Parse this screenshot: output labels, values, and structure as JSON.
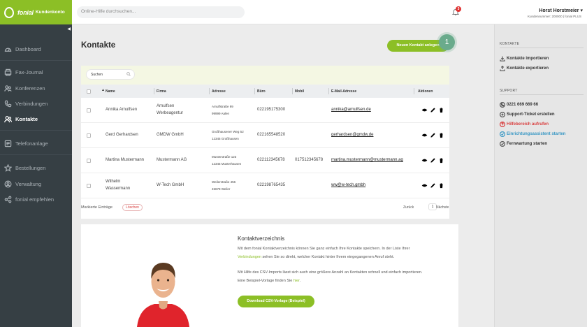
{
  "brand": {
    "name": "fonial",
    "subtitle": "Kundenkonto"
  },
  "topbar": {
    "search_placeholder": "Online-Hilfe durchsuchen...",
    "notification_count": "3",
    "user_name": "Horst Horstmeier ▾",
    "user_sub": "Kundennummer: 200000 | fonial PLUS"
  },
  "sidebar": {
    "collapse": "◀",
    "items": [
      {
        "label": "Dashboard",
        "icon": "dashboard-icon"
      },
      {
        "label": "Fax-Journal",
        "icon": "fax-icon"
      },
      {
        "label": "Konferenzen",
        "icon": "conference-icon"
      },
      {
        "label": "Verbindungen",
        "icon": "phone-icon"
      },
      {
        "label": "Kontakte",
        "icon": "contacts-icon",
        "active": true
      },
      {
        "label": "Telefonanlage",
        "icon": "phone-system-icon"
      },
      {
        "label": "Bestellungen",
        "icon": "star-icon"
      },
      {
        "label": "Verwaltung",
        "icon": "admin-icon"
      },
      {
        "label": "fonial empfehlen",
        "icon": "share-icon"
      }
    ]
  },
  "main": {
    "title": "Kontakte",
    "new_contact_button": "Neuen Kontakt anlegen",
    "step_badge": "1",
    "search_placeholder": "Suchen",
    "columns": {
      "name": "Name",
      "firma": "Firma",
      "adresse": "Adresse",
      "buero": "Büro",
      "mobil": "Mobil",
      "email": "E-Mail-Adresse",
      "aktionen": "Aktionen"
    },
    "rows": [
      {
        "name1": "Annika Arnulfsen",
        "name2": "",
        "firma1": "Arnulfsen",
        "firma2": "Werbeagentur",
        "addr1": "Arnulfstraße 99",
        "addr2": "99999 Aalen",
        "buero": "022195175300",
        "mobil": "",
        "email": "annika@arnulfsen.de"
      },
      {
        "name1": "Gerd Gerhardsen",
        "name2": "",
        "firma1": "GMDW GmbH",
        "firma2": "",
        "addr1": "Großhausener Weg 52",
        "addr2": "12345 Großhausen",
        "buero": "022165548520",
        "mobil": "",
        "email": "gerhardsen@gmdw.de"
      },
      {
        "name1": "Martina Mustermann",
        "name2": "",
        "firma1": "Mustermann AG",
        "firma2": "",
        "addr1": "Musterstraße 123",
        "addr2": "12345 Musterhausen",
        "buero": "022112345678",
        "mobil": "017512345678",
        "email": "martina.mustermann@mustermann.ag"
      },
      {
        "name1": "Wilhelm",
        "name2": "Wassermann",
        "firma1": "W-Tech GmbH",
        "firma2": "",
        "addr1": "Weilerstraße 456",
        "addr2": "45678 Weiler",
        "buero": "022198765435",
        "mobil": "",
        "email": "ww@w-tech.gmbh"
      }
    ],
    "marked_label": "Markierte Einträge",
    "delete_button": "Löschen",
    "pager": {
      "prev": "Zurück",
      "page": "1",
      "next": "Nächste"
    }
  },
  "info": {
    "title": "Kontaktverzeichnis",
    "p1a": "Mit dem fonial Kontaktverzeichnis können Sie ganz einfach Ihre Kontakte speichern. In der Liste Ihrer",
    "p1_link": "Verbindungen",
    "p1b": " sehen Sie so direkt, welcher Kontakt hinter Ihrem eingegangenen Anruf steht.",
    "p2a": "Mit Hilfe des CSV-Imports lässt sich auch eine größere Anzahl an Kontakten schnell und einfach importieren.",
    "p2b": "Eine Beispiel-Vorlage finden Sie ",
    "p2_link": "hier",
    "p2c": ".",
    "download_button": "Download CSV-Vorlage (Beispiel)"
  },
  "rpanel": {
    "kontakte_head": "KONTAKTE",
    "kontakte_items": [
      "Kontakte importieren",
      "Kontakte exportieren"
    ],
    "support_head": "SUPPORT",
    "support_items": [
      {
        "label": "0221 669 669 66",
        "style": "normal",
        "icon": "phone-icon"
      },
      {
        "label": "Support-Ticket erstellen",
        "style": "normal",
        "icon": "ticket-icon"
      },
      {
        "label": "Hilfebereich aufrufen",
        "style": "red",
        "icon": "help-icon"
      },
      {
        "label": "Einrichtungsassistent starten",
        "style": "blue",
        "icon": "wizard-icon"
      },
      {
        "label": "Fernwartung starten",
        "style": "normal",
        "icon": "remote-icon"
      }
    ]
  },
  "colors": {
    "brand_green": "#8cbf26",
    "sidebar_dark": "#363f44",
    "danger_red": "#d94040",
    "link_blue": "#3a98c4"
  }
}
